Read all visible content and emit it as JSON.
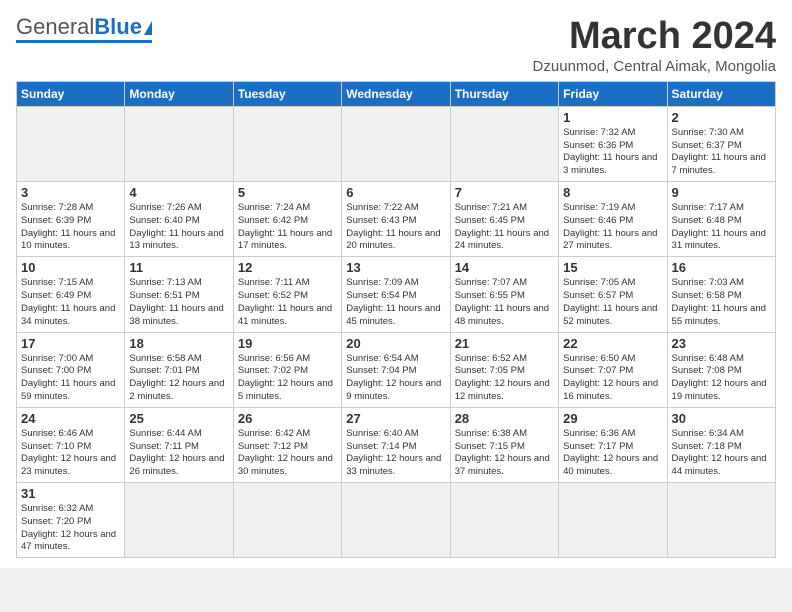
{
  "header": {
    "logo_general": "General",
    "logo_blue": "Blue",
    "month_title": "March 2024",
    "subtitle": "Dzuunmod, Central Aimak, Mongolia"
  },
  "days_of_week": [
    "Sunday",
    "Monday",
    "Tuesday",
    "Wednesday",
    "Thursday",
    "Friday",
    "Saturday"
  ],
  "weeks": [
    [
      {
        "num": "",
        "info": "",
        "empty": true
      },
      {
        "num": "",
        "info": "",
        "empty": true
      },
      {
        "num": "",
        "info": "",
        "empty": true
      },
      {
        "num": "",
        "info": "",
        "empty": true
      },
      {
        "num": "",
        "info": "",
        "empty": true
      },
      {
        "num": "1",
        "info": "Sunrise: 7:32 AM\nSunset: 6:36 PM\nDaylight: 11 hours\nand 3 minutes.",
        "empty": false
      },
      {
        "num": "2",
        "info": "Sunrise: 7:30 AM\nSunset: 6:37 PM\nDaylight: 11 hours\nand 7 minutes.",
        "empty": false
      }
    ],
    [
      {
        "num": "3",
        "info": "Sunrise: 7:28 AM\nSunset: 6:39 PM\nDaylight: 11 hours\nand 10 minutes.",
        "empty": false
      },
      {
        "num": "4",
        "info": "Sunrise: 7:26 AM\nSunset: 6:40 PM\nDaylight: 11 hours\nand 13 minutes.",
        "empty": false
      },
      {
        "num": "5",
        "info": "Sunrise: 7:24 AM\nSunset: 6:42 PM\nDaylight: 11 hours\nand 17 minutes.",
        "empty": false
      },
      {
        "num": "6",
        "info": "Sunrise: 7:22 AM\nSunset: 6:43 PM\nDaylight: 11 hours\nand 20 minutes.",
        "empty": false
      },
      {
        "num": "7",
        "info": "Sunrise: 7:21 AM\nSunset: 6:45 PM\nDaylight: 11 hours\nand 24 minutes.",
        "empty": false
      },
      {
        "num": "8",
        "info": "Sunrise: 7:19 AM\nSunset: 6:46 PM\nDaylight: 11 hours\nand 27 minutes.",
        "empty": false
      },
      {
        "num": "9",
        "info": "Sunrise: 7:17 AM\nSunset: 6:48 PM\nDaylight: 11 hours\nand 31 minutes.",
        "empty": false
      }
    ],
    [
      {
        "num": "10",
        "info": "Sunrise: 7:15 AM\nSunset: 6:49 PM\nDaylight: 11 hours\nand 34 minutes.",
        "empty": false
      },
      {
        "num": "11",
        "info": "Sunrise: 7:13 AM\nSunset: 6:51 PM\nDaylight: 11 hours\nand 38 minutes.",
        "empty": false
      },
      {
        "num": "12",
        "info": "Sunrise: 7:11 AM\nSunset: 6:52 PM\nDaylight: 11 hours\nand 41 minutes.",
        "empty": false
      },
      {
        "num": "13",
        "info": "Sunrise: 7:09 AM\nSunset: 6:54 PM\nDaylight: 11 hours\nand 45 minutes.",
        "empty": false
      },
      {
        "num": "14",
        "info": "Sunrise: 7:07 AM\nSunset: 6:55 PM\nDaylight: 11 hours\nand 48 minutes.",
        "empty": false
      },
      {
        "num": "15",
        "info": "Sunrise: 7:05 AM\nSunset: 6:57 PM\nDaylight: 11 hours\nand 52 minutes.",
        "empty": false
      },
      {
        "num": "16",
        "info": "Sunrise: 7:03 AM\nSunset: 6:58 PM\nDaylight: 11 hours\nand 55 minutes.",
        "empty": false
      }
    ],
    [
      {
        "num": "17",
        "info": "Sunrise: 7:00 AM\nSunset: 7:00 PM\nDaylight: 11 hours\nand 59 minutes.",
        "empty": false
      },
      {
        "num": "18",
        "info": "Sunrise: 6:58 AM\nSunset: 7:01 PM\nDaylight: 12 hours\nand 2 minutes.",
        "empty": false
      },
      {
        "num": "19",
        "info": "Sunrise: 6:56 AM\nSunset: 7:02 PM\nDaylight: 12 hours\nand 5 minutes.",
        "empty": false
      },
      {
        "num": "20",
        "info": "Sunrise: 6:54 AM\nSunset: 7:04 PM\nDaylight: 12 hours\nand 9 minutes.",
        "empty": false
      },
      {
        "num": "21",
        "info": "Sunrise: 6:52 AM\nSunset: 7:05 PM\nDaylight: 12 hours\nand 12 minutes.",
        "empty": false
      },
      {
        "num": "22",
        "info": "Sunrise: 6:50 AM\nSunset: 7:07 PM\nDaylight: 12 hours\nand 16 minutes.",
        "empty": false
      },
      {
        "num": "23",
        "info": "Sunrise: 6:48 AM\nSunset: 7:08 PM\nDaylight: 12 hours\nand 19 minutes.",
        "empty": false
      }
    ],
    [
      {
        "num": "24",
        "info": "Sunrise: 6:46 AM\nSunset: 7:10 PM\nDaylight: 12 hours\nand 23 minutes.",
        "empty": false
      },
      {
        "num": "25",
        "info": "Sunrise: 6:44 AM\nSunset: 7:11 PM\nDaylight: 12 hours\nand 26 minutes.",
        "empty": false
      },
      {
        "num": "26",
        "info": "Sunrise: 6:42 AM\nSunset: 7:12 PM\nDaylight: 12 hours\nand 30 minutes.",
        "empty": false
      },
      {
        "num": "27",
        "info": "Sunrise: 6:40 AM\nSunset: 7:14 PM\nDaylight: 12 hours\nand 33 minutes.",
        "empty": false
      },
      {
        "num": "28",
        "info": "Sunrise: 6:38 AM\nSunset: 7:15 PM\nDaylight: 12 hours\nand 37 minutes.",
        "empty": false
      },
      {
        "num": "29",
        "info": "Sunrise: 6:36 AM\nSunset: 7:17 PM\nDaylight: 12 hours\nand 40 minutes.",
        "empty": false
      },
      {
        "num": "30",
        "info": "Sunrise: 6:34 AM\nSunset: 7:18 PM\nDaylight: 12 hours\nand 44 minutes.",
        "empty": false
      }
    ],
    [
      {
        "num": "31",
        "info": "Sunrise: 6:32 AM\nSunset: 7:20 PM\nDaylight: 12 hours\nand 47 minutes.",
        "empty": false
      },
      {
        "num": "",
        "info": "",
        "empty": true
      },
      {
        "num": "",
        "info": "",
        "empty": true
      },
      {
        "num": "",
        "info": "",
        "empty": true
      },
      {
        "num": "",
        "info": "",
        "empty": true
      },
      {
        "num": "",
        "info": "",
        "empty": true
      },
      {
        "num": "",
        "info": "",
        "empty": true
      }
    ]
  ]
}
